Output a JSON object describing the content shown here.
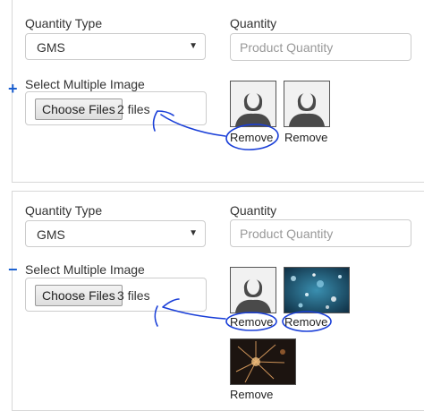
{
  "section1": {
    "qty_type_label": "Quantity Type",
    "qty_type_value": "GMS",
    "qty_label": "Quantity",
    "qty_placeholder": "Product Quantity",
    "select_images_label": "Select Multiple Image",
    "choose_files": "Choose Files",
    "files_count": "2 files",
    "remove": [
      "Remove",
      "Remove"
    ],
    "toggle": "+"
  },
  "section2": {
    "qty_type_label": "Quantity Type",
    "qty_type_value": "GMS",
    "qty_label": "Quantity",
    "qty_placeholder": "Product Quantity",
    "select_images_label": "Select Multiple Image",
    "choose_files": "Choose Files",
    "files_count": "3 files",
    "remove": [
      "Remove",
      "Remove",
      "Remove"
    ],
    "toggle": "−"
  },
  "colors": {
    "annotation_ink": "#1a3fd8",
    "toggle_blue": "#1a5fd0"
  }
}
